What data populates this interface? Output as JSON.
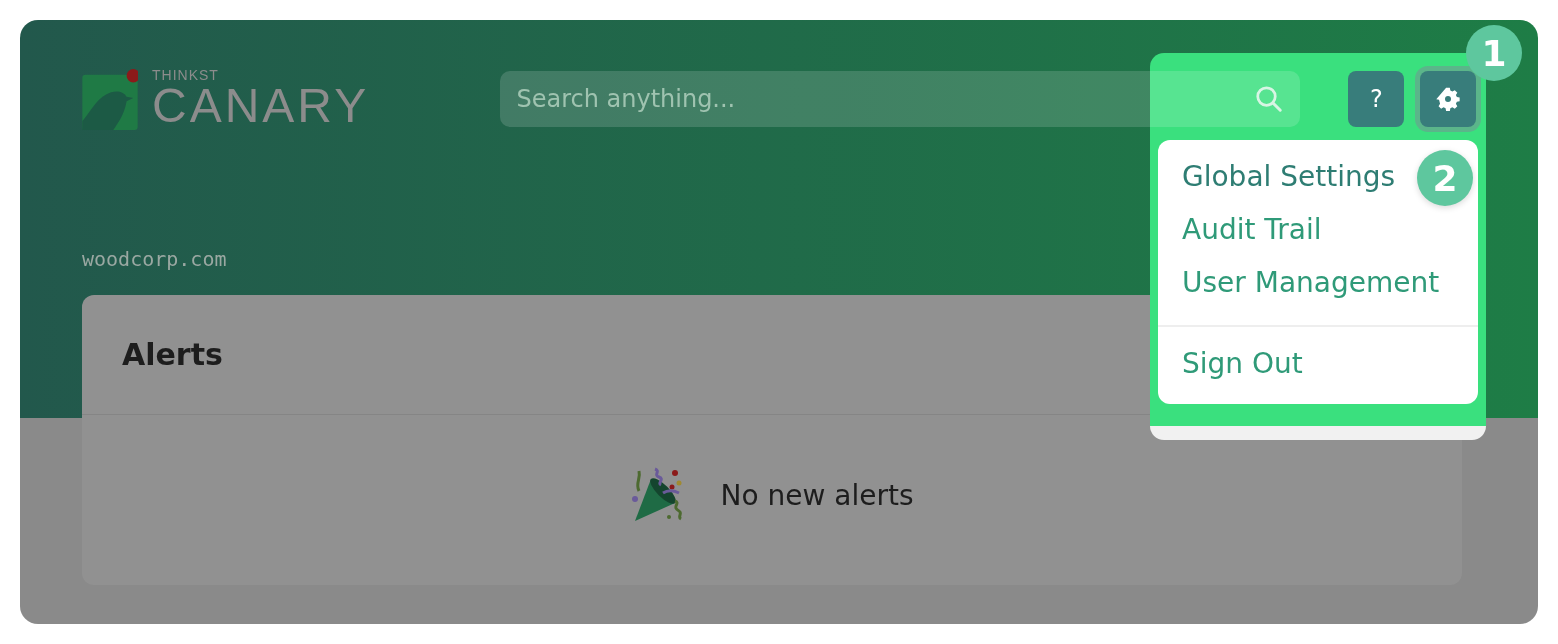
{
  "logo": {
    "small": "THINKST",
    "large": "CANARY"
  },
  "search": {
    "placeholder": "Search anything..."
  },
  "help_button": {
    "label": "?"
  },
  "settings_button": {
    "expanded": true
  },
  "tenant": "woodcorp.com",
  "menu": {
    "sections": [
      [
        "Global Settings",
        "Audit Trail",
        "User Management"
      ],
      [
        "Sign Out"
      ]
    ]
  },
  "settings_step_badge": "1",
  "menu_step_badge": "2",
  "alerts": {
    "title": "Alerts",
    "empty_message": "No new alerts"
  }
}
